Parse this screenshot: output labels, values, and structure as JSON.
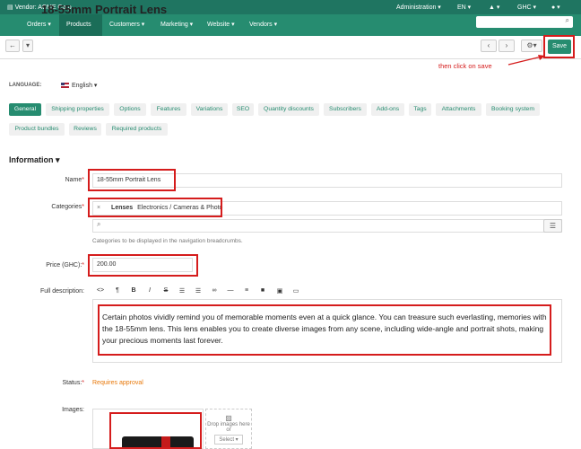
{
  "topbar": {
    "vendor": "Vendor: ACME Corp",
    "administration": "Administration",
    "language": "EN",
    "currency": "GHC"
  },
  "nav": {
    "items": [
      "Orders",
      "Products",
      "Customers",
      "Marketing",
      "Website",
      "Vendors"
    ]
  },
  "header": {
    "title": "18-55mm Portrait Lens",
    "save_label": "Save"
  },
  "annotation": "then click on save",
  "language": {
    "label": "LANGUAGE:",
    "value": "English"
  },
  "tabs": [
    "General",
    "Shipping properties",
    "Options",
    "Features",
    "Variations",
    "SEO",
    "Quantity discounts",
    "Subscribers",
    "Add-ons",
    "Tags",
    "Attachments",
    "Booking system",
    "Product bundles",
    "Reviews",
    "Required products"
  ],
  "information": {
    "title": "Information",
    "name_label": "Name",
    "name_value": "18-55mm Portrait Lens",
    "categories_label": "Categories",
    "category_name": "Lenses",
    "category_path": "Electronics / Cameras & Photo",
    "categories_hint": "Categories to be displayed in the navigation breadcrumbs.",
    "price_label": "Price (GHC):",
    "price_value": "200.00",
    "description_label": "Full description:",
    "description_text": "Certain photos vividly remind you of memorable moments even at a quick glance. You can treasure such everlasting, memories with the 18-55mm lens. This lens enables you to create diverse images from any scene, including wide-angle and portrait shots, making your precious moments last forever.",
    "status_label": "Status:",
    "status_value": "Requires approval",
    "images_label": "Images:",
    "drop_text": "Drop images here",
    "drop_or": "or",
    "select_label": "Select"
  },
  "colors": {
    "brand": "#268c70",
    "annotation": "#d51c1c",
    "status": "#e8790b"
  }
}
